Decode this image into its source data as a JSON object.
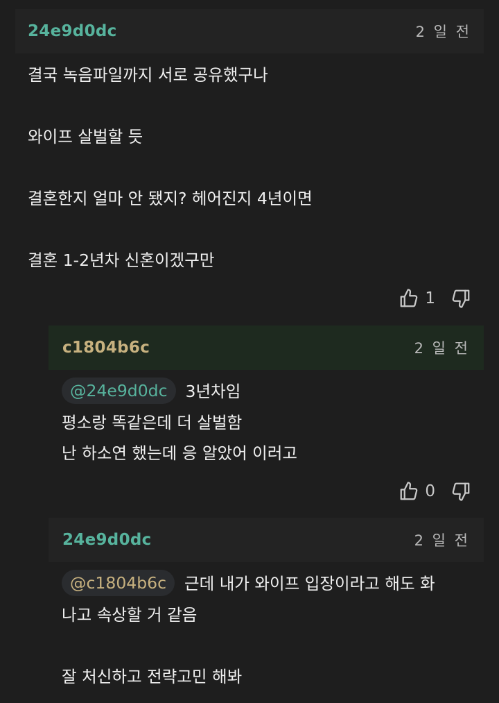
{
  "colors": {
    "background": "#1e1e1e",
    "header_bg": "#232323",
    "reply_header_bg": "#1e2a1f",
    "nick_teal": "#57b39d",
    "nick_tan": "#c7b17f",
    "mention_bg": "#2a2c2f",
    "text": "#f0f0f0",
    "meta": "#b8b8b8"
  },
  "comments": [
    {
      "nickname": "24e9d0dc",
      "time": "2 일 전",
      "lines": [
        "결국 녹음파일까지 서로 공유했구나",
        "",
        "와이프 살벌할 듯",
        "",
        "결혼한지 얼마 안 됐지? 헤어진지 4년이면",
        "",
        "결혼 1-2년차 신혼이겠구만"
      ],
      "upvotes": "1",
      "icons": {
        "up": "thumbs-up-icon",
        "down": "thumbs-down-icon"
      }
    },
    {
      "nickname": "c1804b6c",
      "time": "2 일 전",
      "mention": "@24e9d0dc",
      "lines": [
        "3년차임",
        "평소랑 똑같은데 더 살벌함",
        "난 하소연 했는데 응 알았어 이러고"
      ],
      "upvotes": "0",
      "icons": {
        "up": "thumbs-up-icon",
        "down": "thumbs-down-icon"
      }
    },
    {
      "nickname": "24e9d0dc",
      "time": "2 일 전",
      "mention": "@c1804b6c",
      "lines": [
        "근데 내가 와이프 입장이라고 해도 화",
        "나고 속상할 거 같음",
        "",
        "잘 처신하고 전략고민 해봐"
      ]
    }
  ]
}
